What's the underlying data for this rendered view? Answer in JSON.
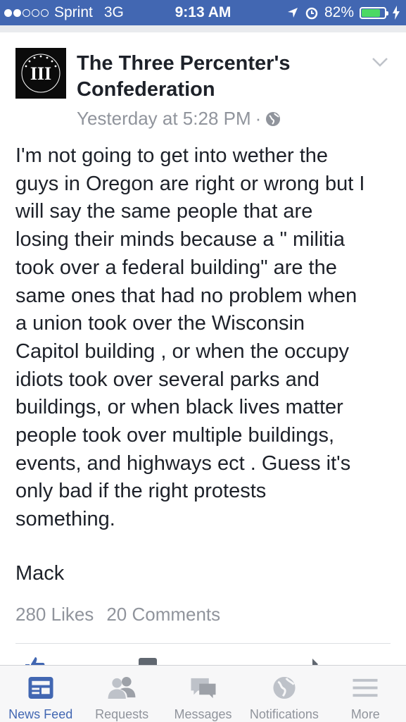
{
  "status_bar": {
    "carrier": "Sprint",
    "network": "3G",
    "time": "9:13 AM",
    "battery": "82%",
    "battery_level": 0.82
  },
  "post": {
    "page_name": "The Three Percenter's Confederation",
    "timestamp": "Yesterday at 5:28 PM",
    "separator": "·",
    "text": "I'm not going to get into wether the\nguys in Oregon are right or wrong but I\nwill say the same people that are\nlosing their minds because a \" militia\ntook over a federal building\" are the\nsame ones that had no problem when\na union took over the Wisconsin\nCapitol building , or when the occupy\nidiots took over several parks and\nbuildings, or when black lives matter\npeople took over multiple buildings,\nevents, and highways ect . Guess it's\nonly bad if the right protests\nsomething.",
    "signature": "Mack",
    "likes": "280 Likes",
    "comments": "20 Comments",
    "logo_text": "III"
  },
  "tabbar": {
    "items": [
      {
        "label": "News Feed",
        "icon": "news-feed-icon",
        "active": true
      },
      {
        "label": "Requests",
        "icon": "friend-requests-icon"
      },
      {
        "label": "Messages",
        "icon": "messages-icon"
      },
      {
        "label": "Notifications",
        "icon": "globe-icon"
      },
      {
        "label": "More",
        "icon": "menu-icon"
      }
    ]
  },
  "colors": {
    "brand": "#4267b2",
    "secondary_text": "#90949c",
    "battery_fill": "#4cd964"
  }
}
